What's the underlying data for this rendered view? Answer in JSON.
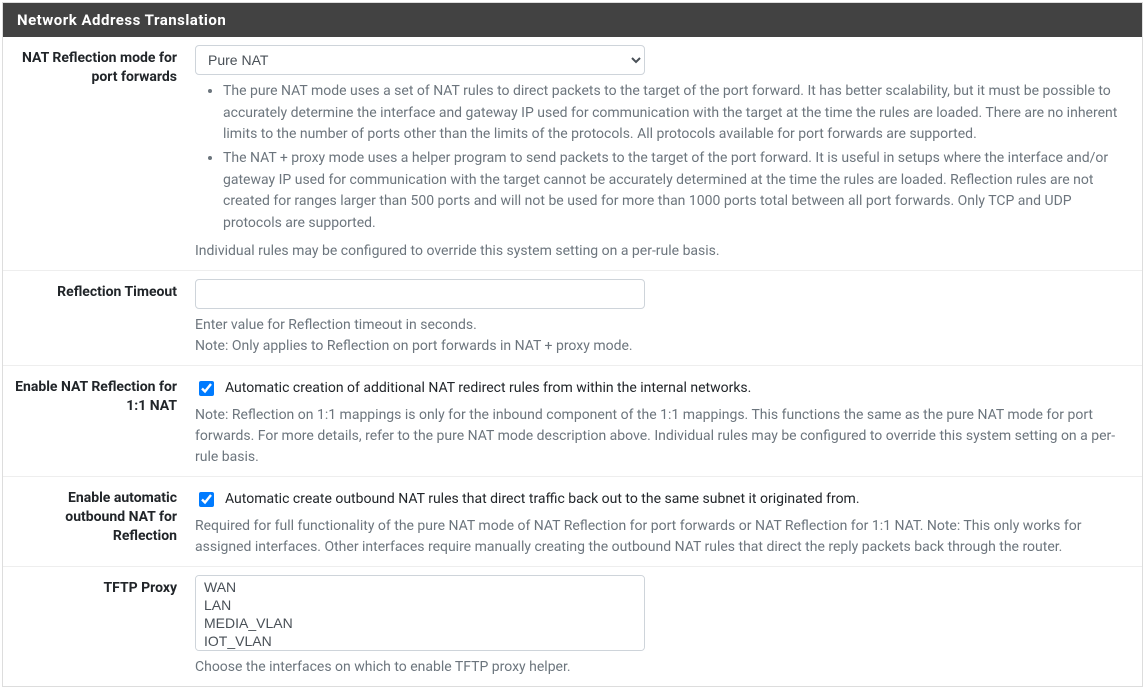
{
  "panel_title": "Network Address Translation",
  "nat_reflection": {
    "label": "NAT Reflection mode for port forwards",
    "value": "Pure NAT",
    "help_bullets": [
      "The pure NAT mode uses a set of NAT rules to direct packets to the target of the port forward. It has better scalability, but it must be possible to accurately determine the interface and gateway IP used for communication with the target at the time the rules are loaded. There are no inherent limits to the number of ports other than the limits of the protocols. All protocols available for port forwards are supported.",
      "The NAT + proxy mode uses a helper program to send packets to the target of the port forward. It is useful in setups where the interface and/or gateway IP used for communication with the target cannot be accurately determined at the time the rules are loaded. Reflection rules are not created for ranges larger than 500 ports and will not be used for more than 1000 ports total between all port forwards. Only TCP and UDP protocols are supported."
    ],
    "help_footer": "Individual rules may be configured to override this system setting on a per-rule basis."
  },
  "reflection_timeout": {
    "label": "Reflection Timeout",
    "value": "",
    "help1": "Enter value for Reflection timeout in seconds.",
    "help2": "Note: Only applies to Reflection on port forwards in NAT + proxy mode."
  },
  "enable_11": {
    "label": "Enable NAT Reflection for 1:1 NAT",
    "checked": true,
    "checkbox_text": "Automatic creation of additional NAT redirect rules from within the internal networks.",
    "help": "Note: Reflection on 1:1 mappings is only for the inbound component of the 1:1 mappings. This functions the same as the pure NAT mode for port forwards. For more details, refer to the pure NAT mode description above. Individual rules may be configured to override this system setting on a per-rule basis."
  },
  "auto_outbound": {
    "label": "Enable automatic outbound NAT for Reflection",
    "checked": true,
    "checkbox_text": "Automatic create outbound NAT rules that direct traffic back out to the same subnet it originated from.",
    "help": "Required for full functionality of the pure NAT mode of NAT Reflection for port forwards or NAT Reflection for 1:1 NAT. Note: This only works for assigned interfaces. Other interfaces require manually creating the outbound NAT rules that direct the reply packets back through the router."
  },
  "tftp": {
    "label": "TFTP Proxy",
    "options": [
      "WAN",
      "LAN",
      "MEDIA_VLAN",
      "IOT_VLAN"
    ],
    "help": "Choose the interfaces on which to enable TFTP proxy helper."
  }
}
